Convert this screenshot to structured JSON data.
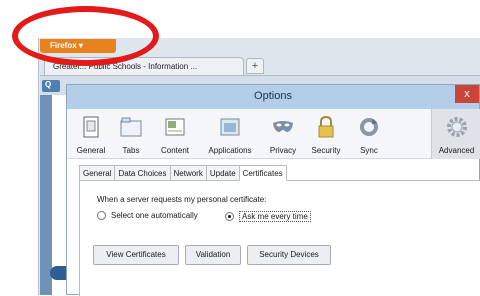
{
  "browser": {
    "firefox_button": "Firefox",
    "tab_title": "Greater... Public Schools - Information ...",
    "new_tab": "+",
    "sidebar_button": "Q"
  },
  "dialog": {
    "title": "Options",
    "close": "x",
    "panes": [
      {
        "label": "General",
        "icon": "general-icon"
      },
      {
        "label": "Tabs",
        "icon": "tabs-icon"
      },
      {
        "label": "Content",
        "icon": "content-icon"
      },
      {
        "label": "Applications",
        "icon": "applications-icon"
      },
      {
        "label": "Privacy",
        "icon": "privacy-mask-icon"
      },
      {
        "label": "Security",
        "icon": "lock-icon"
      },
      {
        "label": "Sync",
        "icon": "sync-icon"
      },
      {
        "label": "Advanced",
        "icon": "gear-icon"
      }
    ],
    "subtabs": [
      "General",
      "Data Choices",
      "Network",
      "Update",
      "Certificates"
    ],
    "prompt": "When a server requests my personal certificate:",
    "radio_auto": "Select one automatically",
    "radio_ask": "Ask me every time",
    "selected": "Ask me every time",
    "buttons": {
      "view": "View Certificates",
      "validation": "Validation",
      "devices": "Security Devices"
    }
  },
  "colors": {
    "firefox_orange": "#e8821e",
    "highlight_ring": "#e21a1a",
    "titlebar": "#b4cde9",
    "close": "#c9453a"
  }
}
